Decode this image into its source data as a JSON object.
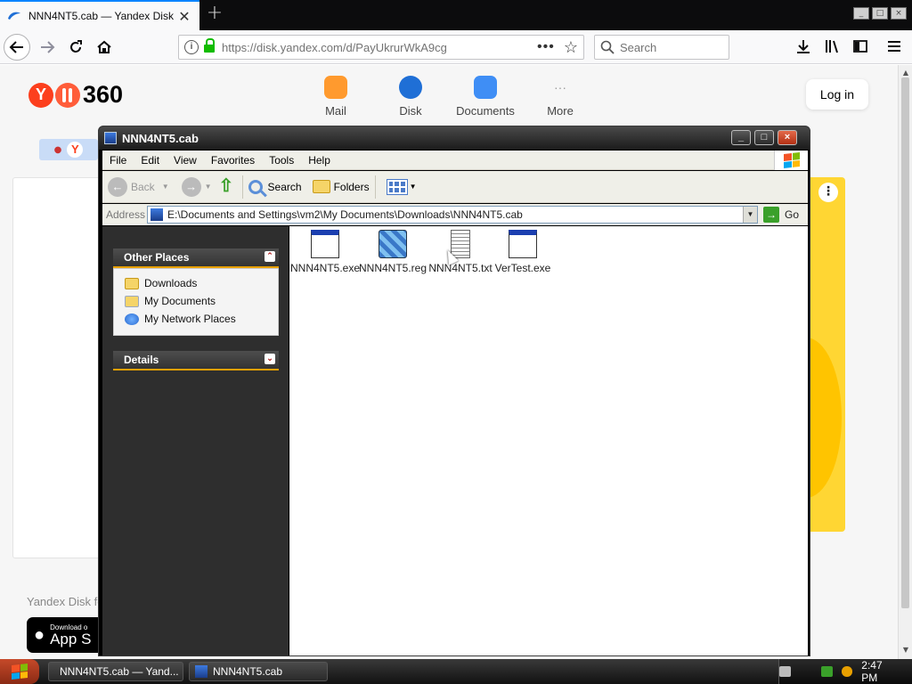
{
  "browser": {
    "tab_title": "NNN4NT5.cab — Yandex Disk",
    "url": "https://disk.yandex.com/d/PayUkrurWkA9cg",
    "search_placeholder": "Search",
    "close_tab_glyph": "✕",
    "new_tab_glyph": "+",
    "page_actions_glyph": "•••",
    "bookmark_glyph": "☆"
  },
  "yandex": {
    "logo_text": "360",
    "logo_letter": "Y",
    "apps": [
      {
        "label": "Mail",
        "color": "#ff9a2e"
      },
      {
        "label": "Disk",
        "color": "#1f6fd6"
      },
      {
        "label": "Documents",
        "color": "#3f8ef5"
      },
      {
        "label": "More",
        "color": "#9a9a9a"
      }
    ],
    "login_label": "Log in",
    "footer_text": "Yandex Disk fo",
    "appstore_small": "Download o",
    "appstore_big": "App S"
  },
  "explorer": {
    "title": "NNN4NT5.cab",
    "menu": [
      "File",
      "Edit",
      "View",
      "Favorites",
      "Tools",
      "Help"
    ],
    "toolbar": {
      "back": "Back",
      "search": "Search",
      "folders": "Folders"
    },
    "address_label": "Address",
    "address": "E:\\Documents and Settings\\vm2\\My Documents\\Downloads\\NNN4NT5.cab",
    "go_label": "Go",
    "other_places": {
      "title": "Other Places",
      "links": [
        "Downloads",
        "My Documents",
        "My Network Places"
      ]
    },
    "details": {
      "title": "Details"
    },
    "files": [
      {
        "name": "NNN4NT5.exe",
        "icon": "exe-icon"
      },
      {
        "name": "NNN4NT5.reg",
        "icon": "registry-icon"
      },
      {
        "name": "NNN4NT5.txt",
        "icon": "text-file-icon"
      },
      {
        "name": "VerTest.exe",
        "icon": "exe-icon"
      }
    ]
  },
  "taskbar": {
    "tasks": [
      "NNN4NT5.cab — Yand...",
      "NNN4NT5.cab"
    ],
    "clock": "2:47 PM"
  },
  "colors": {
    "firefox_accent": "#0a84ff",
    "yandex_red": "#fc3f1d",
    "xp_group_accent": "#e8a000"
  }
}
